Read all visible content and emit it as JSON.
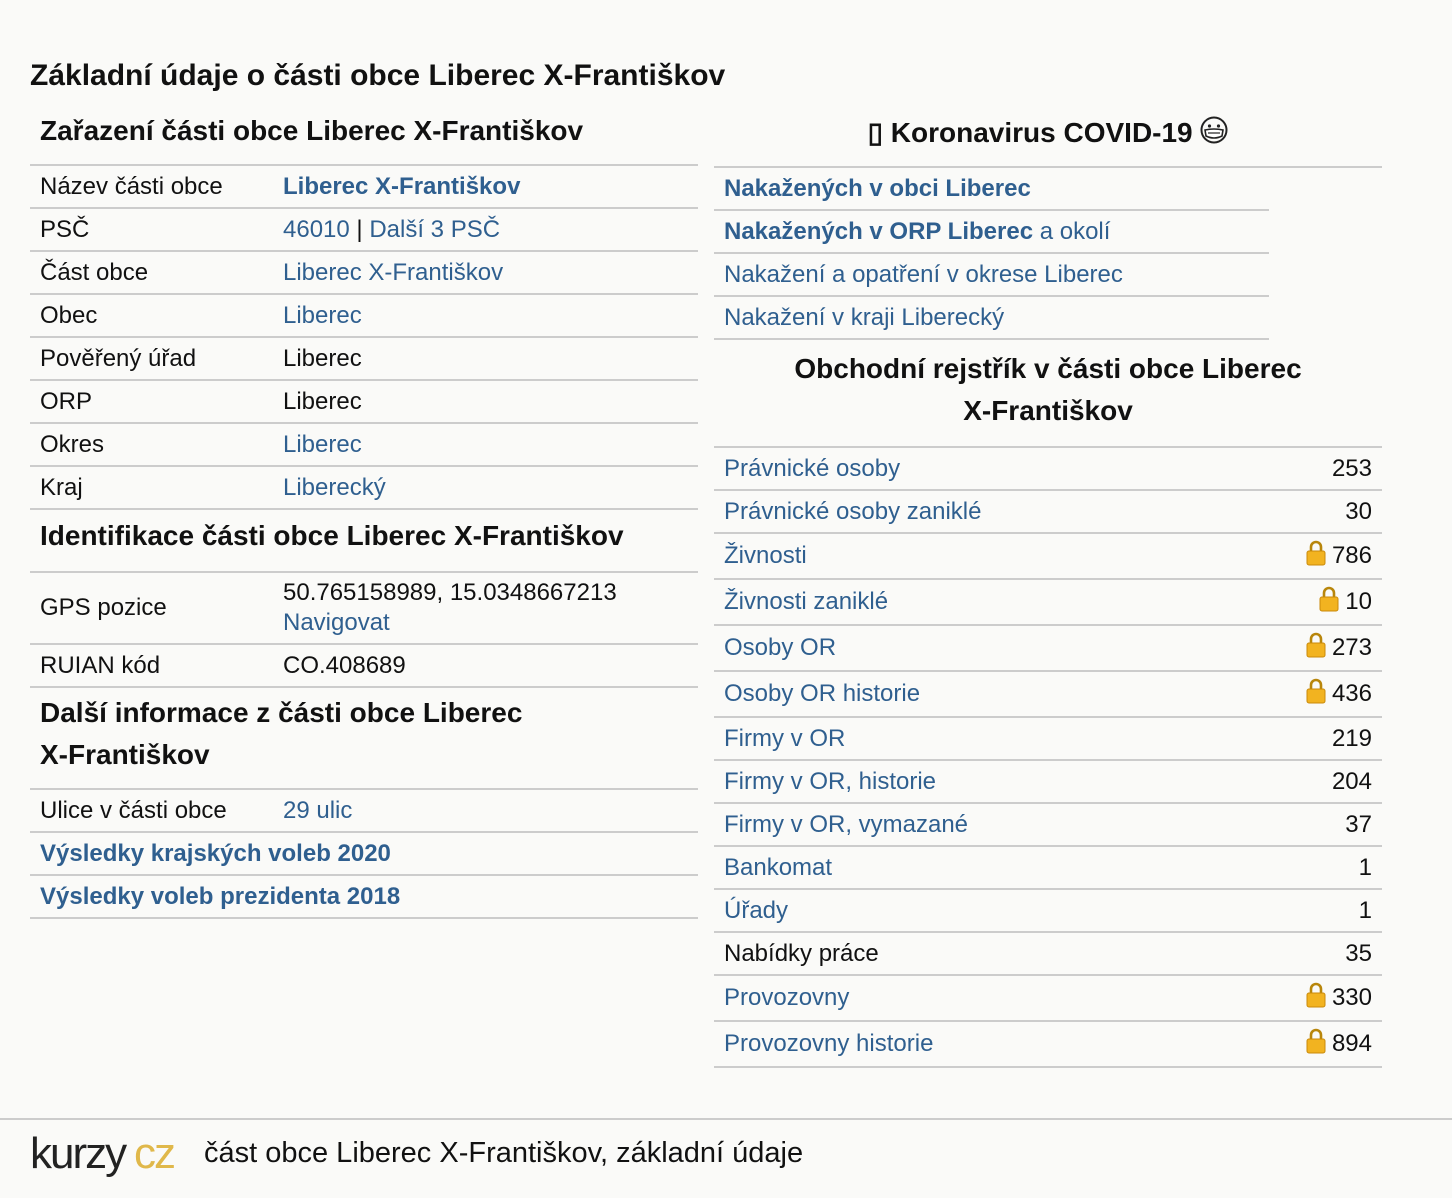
{
  "title": "Základní údaje o části obce Liberec X-Františkov",
  "zarazeni": {
    "heading": "Zařazení části obce Liberec X-Františkov",
    "rows": [
      {
        "label": "Název části obce",
        "value": "Liberec X-Františkov"
      },
      {
        "label": "PSČ",
        "value": "46010",
        "sep": " | ",
        "extra": "Další 3 PSČ"
      },
      {
        "label": "Část obce",
        "value": "Liberec X-Františkov"
      },
      {
        "label": "Obec",
        "value": "Liberec"
      },
      {
        "label": "Pověřený úřad",
        "value": "Liberec"
      },
      {
        "label": "ORP",
        "value": "Liberec"
      },
      {
        "label": "Okres",
        "value": "Liberec"
      },
      {
        "label": "Kraj",
        "value": "Liberecký"
      }
    ]
  },
  "identifikace": {
    "heading": "Identifikace části obce Liberec X-Františkov",
    "gps_label": "GPS pozice",
    "gps_value": "50.765158989, 15.0348667213",
    "gps_link": "Navigovat",
    "ruian_label": "RUIAN kód",
    "ruian_value": "CO.408689"
  },
  "dalsi": {
    "heading_line1": "Další informace z části obce Liberec",
    "heading_line2": "X-Františkov",
    "ulice_label": "Ulice v části obce",
    "ulice_value": "29 ulic",
    "links": [
      "Výsledky krajských voleb 2020",
      "Výsledky voleb prezidenta 2018"
    ]
  },
  "covid": {
    "heading_icon": "▯",
    "heading_text": "Koronavirus COVID-19",
    "heading_emoji": "😷",
    "link1": "Nakažených v obci Liberec",
    "link2_bold": "Nakažených v ORP Liberec",
    "link2_rest": " a okolí",
    "link3": "Nakažení a opatření v okrese Liberec",
    "link4": "Nakažení v kraji Liberecký"
  },
  "obchodni": {
    "heading_line1": "Obchodní rejstřík v části obce Liberec",
    "heading_line2": "X-Františkov",
    "rows": [
      {
        "label": "Právnické osoby",
        "value": "253",
        "locked": false,
        "link": true
      },
      {
        "label": "Právnické osoby zaniklé",
        "value": "30",
        "locked": false,
        "link": true
      },
      {
        "label": "Živnosti",
        "value": "786",
        "locked": true,
        "link": true
      },
      {
        "label": "Živnosti zaniklé",
        "value": "10",
        "locked": true,
        "link": true
      },
      {
        "label": "Osoby OR",
        "value": "273",
        "locked": true,
        "link": true
      },
      {
        "label": "Osoby OR historie",
        "value": "436",
        "locked": true,
        "link": true
      },
      {
        "label": "Firmy v OR",
        "value": "219",
        "locked": false,
        "link": true
      },
      {
        "label": "Firmy v OR, historie",
        "value": "204",
        "locked": false,
        "link": true
      },
      {
        "label": "Firmy v OR, vymazané",
        "value": "37",
        "locked": false,
        "link": true
      },
      {
        "label": "Bankomat",
        "value": "1",
        "locked": false,
        "link": true
      },
      {
        "label": "Úřady",
        "value": "1",
        "locked": false,
        "link": true
      },
      {
        "label": "Nabídky práce",
        "value": "35",
        "locked": false,
        "link": false
      },
      {
        "label": "Provozovny",
        "value": "330",
        "locked": true,
        "link": true
      },
      {
        "label": "Provozovny historie",
        "value": "894",
        "locked": true,
        "link": true
      }
    ]
  },
  "footer": {
    "logo_part1": "kurzy",
    "logo_part2": "cz",
    "text": "část obce Liberec X-Františkov, základní údaje"
  },
  "colors": {
    "link": "#2f5f8f",
    "logo_accent": "#e0b84a",
    "divider": "#cccccc"
  },
  "icons": {
    "lock": "lock-icon",
    "mask": "face-mask-emoji"
  }
}
